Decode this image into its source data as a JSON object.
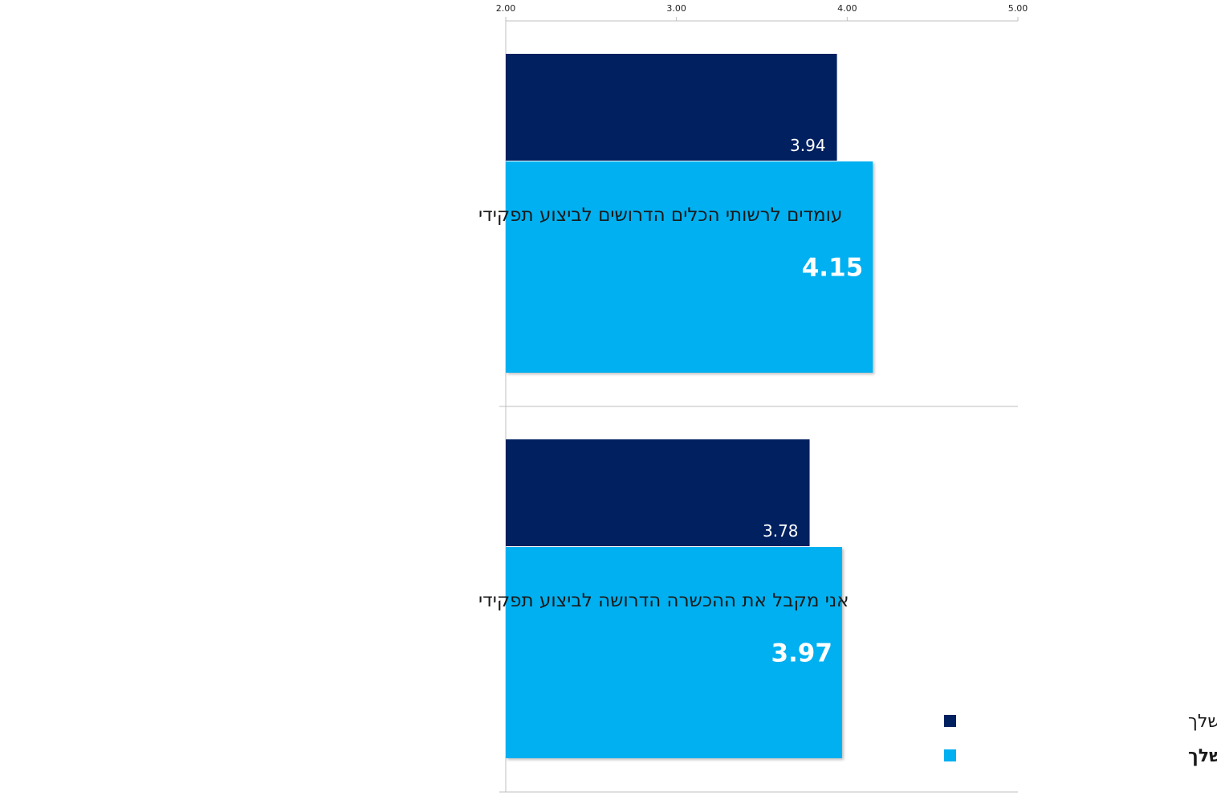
{
  "chart_data": {
    "type": "bar",
    "orientation": "horizontal",
    "xlim": [
      2,
      5
    ],
    "x_ticks": [
      "2.00",
      "3.00",
      "4.00",
      "5.00"
    ],
    "axis_position": "top",
    "grid": false,
    "legend_position": "bottom-right",
    "categories": [
      "עומדים לרשותי הכלים הדרושים לביצוע תפקידי",
      "אני מקבל את ההכשרה הדרושה לביצוע תפקידי"
    ],
    "series": [
      {
        "name": "כלל הארגון ללא האזור שלך",
        "color": "#002060",
        "values": [
          3.94,
          3.78
        ],
        "labels": [
          "3.94",
          "3.78"
        ]
      },
      {
        "name": "האזור שלך",
        "color": "#00B0F0",
        "values": [
          4.15,
          3.97
        ],
        "labels": [
          "4.15",
          "3.97"
        ]
      }
    ]
  }
}
